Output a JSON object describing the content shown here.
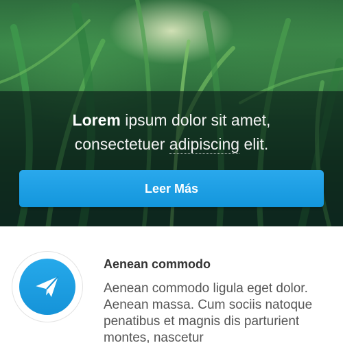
{
  "hero": {
    "headline_strong": "Lorem",
    "headline_rest_line1": " ipsum dolor sit amet,",
    "headline_line2_start": "consectetuer ",
    "headline_abbr": "adipiscing",
    "headline_line2_end": " elit.",
    "cta_label": "Leer Más"
  },
  "feature": {
    "icon": "paper-plane-icon",
    "title": "Aenean commodo",
    "body": "Aenean commodo ligula eget dolor. Aenean massa. Cum sociis natoque penatibus et magnis dis parturient montes, nascetur"
  },
  "colors": {
    "accent": "#1A9FE6",
    "overlay": "#081C16",
    "title_text": "#333333",
    "body_text": "#555555"
  }
}
